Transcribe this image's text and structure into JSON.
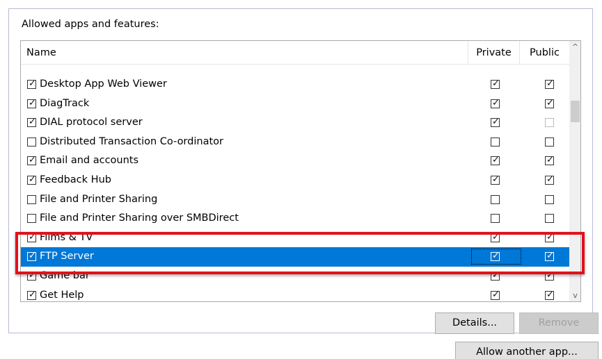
{
  "group_label": "Allowed apps and features:",
  "columns": {
    "name": "Name",
    "private": "Private",
    "public": "Public"
  },
  "rows": [
    {
      "label": "Desktop App Web Viewer",
      "enabled": true,
      "private": true,
      "public": true
    },
    {
      "label": "DiagTrack",
      "enabled": true,
      "private": true,
      "public": true
    },
    {
      "label": "DIAL protocol server",
      "enabled": true,
      "private": true,
      "public": false,
      "public_disabled": true
    },
    {
      "label": "Distributed Transaction Co-ordinator",
      "enabled": false,
      "private": false,
      "public": false
    },
    {
      "label": "Email and accounts",
      "enabled": true,
      "private": true,
      "public": true
    },
    {
      "label": "Feedback Hub",
      "enabled": true,
      "private": true,
      "public": true
    },
    {
      "label": "File and Printer Sharing",
      "enabled": false,
      "private": false,
      "public": false
    },
    {
      "label": "File and Printer Sharing over SMBDirect",
      "enabled": false,
      "private": false,
      "public": false
    },
    {
      "label": "Films & TV",
      "enabled": true,
      "private": true,
      "public": true
    },
    {
      "label": "FTP Server",
      "enabled": true,
      "private": true,
      "public": true,
      "selected": true
    },
    {
      "label": "Game bar",
      "enabled": true,
      "private": true,
      "public": true
    },
    {
      "label": "Get Help",
      "enabled": true,
      "private": true,
      "public": true
    }
  ],
  "buttons": {
    "details": "Details...",
    "remove": "Remove",
    "allow_another": "Allow another app..."
  },
  "icons": {
    "check": "✓",
    "scroll_up": "^",
    "scroll_down": "v"
  },
  "colors": {
    "selection": "#0078d7",
    "highlight_border": "#e3101a"
  }
}
